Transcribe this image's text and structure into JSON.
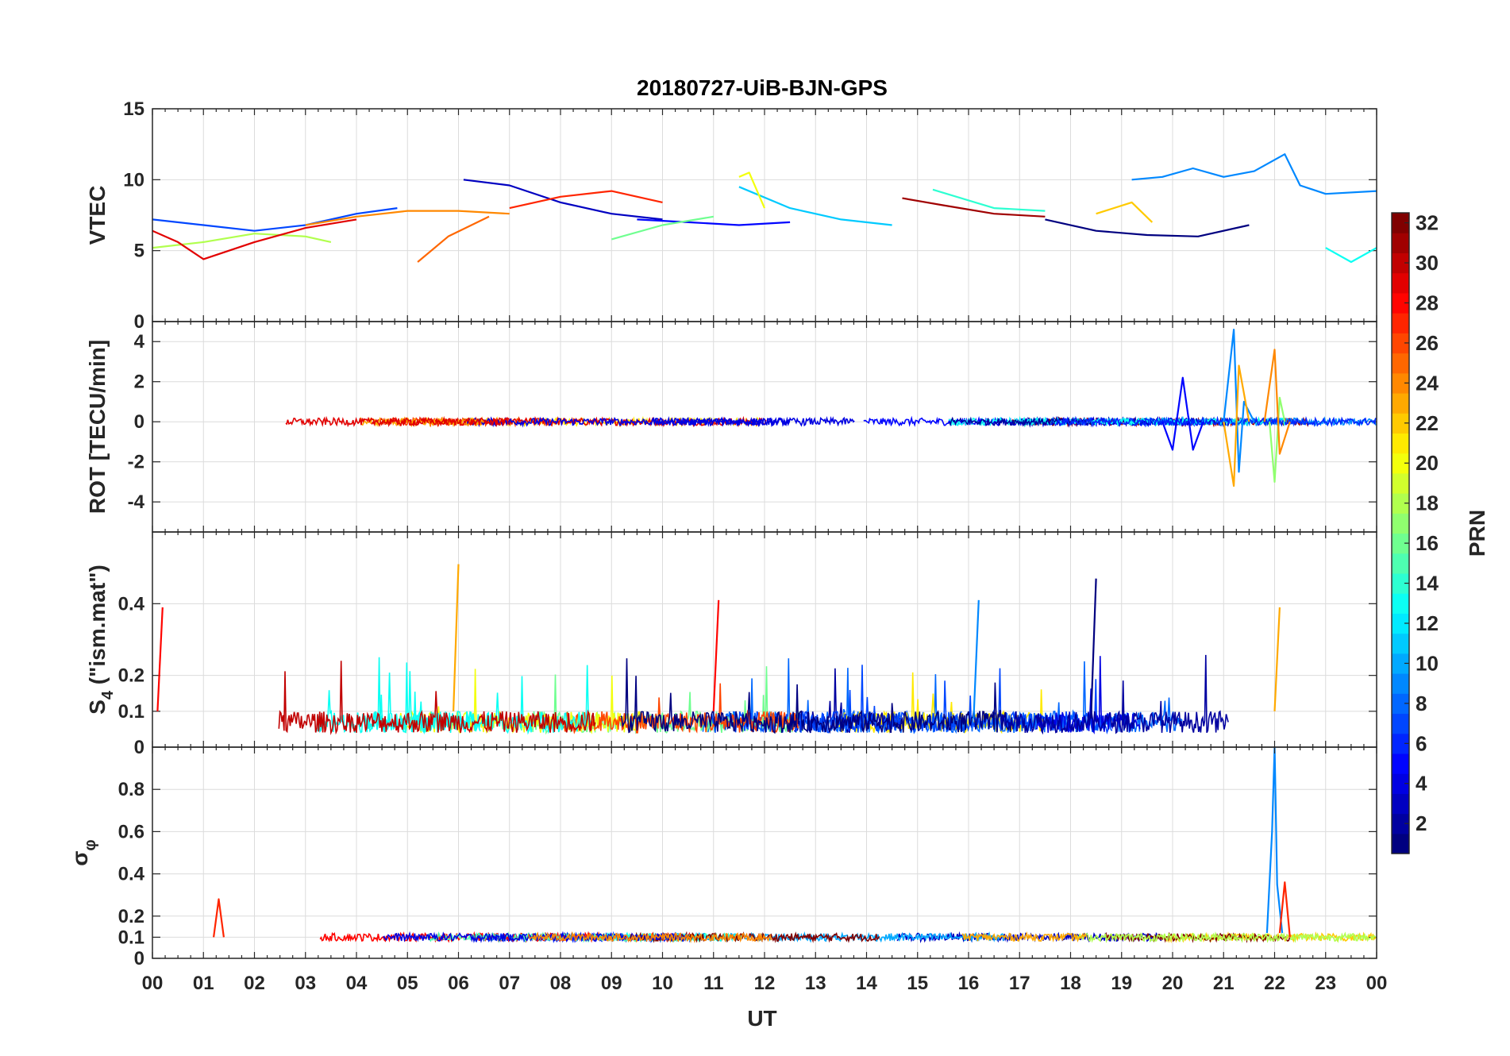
{
  "figure": {
    "title": "20180727-UiB-BJN-GPS",
    "xlabel": "UT",
    "x_ticks": [
      "00",
      "01",
      "02",
      "03",
      "04",
      "05",
      "06",
      "07",
      "08",
      "09",
      "10",
      "11",
      "12",
      "13",
      "14",
      "15",
      "16",
      "17",
      "18",
      "19",
      "20",
      "21",
      "22",
      "23",
      "00"
    ]
  },
  "colorbar": {
    "label": "PRN",
    "colormap": "jet",
    "range": [
      1,
      32
    ],
    "ticks": [
      "2",
      "4",
      "6",
      "8",
      "10",
      "12",
      "14",
      "16",
      "18",
      "20",
      "22",
      "24",
      "26",
      "28",
      "30",
      "32"
    ]
  },
  "chart_data": [
    {
      "type": "line",
      "panel": "vtec",
      "ylabel": "VTEC",
      "xlim": [
        0,
        24
      ],
      "ylim": [
        0,
        15
      ],
      "y_ticks": [
        "0",
        "5",
        "10",
        "15"
      ],
      "grid": true,
      "series_color_by": "PRN",
      "series": [
        {
          "prn": 1,
          "x": [
            17.5,
            18.5,
            19.5,
            20.5,
            21.5
          ],
          "y": [
            7.2,
            6.4,
            6.1,
            6.0,
            6.8
          ]
        },
        {
          "prn": 3,
          "x": [
            6.1,
            7.0,
            8.0,
            9.0,
            10.0
          ],
          "y": [
            10.0,
            9.6,
            8.4,
            7.6,
            7.2
          ]
        },
        {
          "prn": 5,
          "x": [
            9.5,
            10.5,
            11.5,
            12.5
          ],
          "y": [
            7.2,
            7.0,
            6.8,
            7.0
          ]
        },
        {
          "prn": 7,
          "x": [
            0.0,
            1.0,
            2.0,
            3.0,
            4.0,
            4.8
          ],
          "y": [
            7.2,
            6.8,
            6.4,
            6.8,
            7.6,
            8.0
          ]
        },
        {
          "prn": 9,
          "x": [
            19.2,
            19.8,
            20.4,
            21.0,
            21.6,
            22.2,
            22.5,
            23.0,
            24.0
          ],
          "y": [
            10.0,
            10.2,
            10.8,
            10.2,
            10.6,
            11.8,
            9.6,
            9.0,
            9.2
          ]
        },
        {
          "prn": 11,
          "x": [
            11.5,
            12.5,
            13.5,
            14.5
          ],
          "y": [
            9.5,
            8.0,
            7.2,
            6.8
          ]
        },
        {
          "prn": 13,
          "x": [
            23.0,
            23.5,
            24.0
          ],
          "y": [
            5.2,
            4.2,
            5.2
          ]
        },
        {
          "prn": 14,
          "x": [
            15.3,
            16.5,
            17.5
          ],
          "y": [
            9.3,
            8.0,
            7.8
          ]
        },
        {
          "prn": 16,
          "x": [
            9.0,
            10.0,
            11.0
          ],
          "y": [
            5.8,
            6.8,
            7.4
          ]
        },
        {
          "prn": 18,
          "x": [
            0.0,
            1.0,
            2.0,
            3.0,
            3.5
          ],
          "y": [
            5.2,
            5.6,
            6.2,
            6.0,
            5.6
          ]
        },
        {
          "prn": 20,
          "x": [
            11.5,
            11.7,
            12.0
          ],
          "y": [
            10.2,
            10.5,
            8.0
          ]
        },
        {
          "prn": 22,
          "x": [
            18.5,
            19.2,
            19.6
          ],
          "y": [
            7.6,
            8.4,
            7.0
          ]
        },
        {
          "prn": 24,
          "x": [
            3.0,
            4.0,
            5.0,
            6.0,
            7.0
          ],
          "y": [
            6.8,
            7.4,
            7.8,
            7.8,
            7.6
          ]
        },
        {
          "prn": 25,
          "x": [
            5.2,
            5.8,
            6.6
          ],
          "y": [
            4.2,
            6.0,
            7.4
          ]
        },
        {
          "prn": 27,
          "x": [
            7.0,
            8.0,
            9.0,
            10.0
          ],
          "y": [
            8.0,
            8.8,
            9.2,
            8.4
          ]
        },
        {
          "prn": 29,
          "x": [
            0.0,
            0.5,
            1.0,
            2.0,
            3.0,
            4.0
          ],
          "y": [
            6.4,
            5.6,
            4.4,
            5.6,
            6.6,
            7.2
          ]
        },
        {
          "prn": 31,
          "x": [
            14.7,
            15.5,
            16.5,
            17.5
          ],
          "y": [
            8.7,
            8.2,
            7.6,
            7.4
          ]
        }
      ]
    },
    {
      "type": "line",
      "panel": "rot",
      "ylabel": "ROT [TECU/min]",
      "xlim": [
        0,
        24
      ],
      "ylim": [
        -5.5,
        5
      ],
      "y_ticks": [
        "-4",
        "-2",
        "0",
        "2",
        "4"
      ],
      "grid": true,
      "series_color_by": "PRN",
      "series": [
        {
          "prn": 5,
          "x": [
            19.8,
            20.0,
            20.2,
            20.4,
            20.6
          ],
          "y": [
            0.0,
            -1.4,
            2.2,
            -1.4,
            0.0
          ]
        },
        {
          "prn": 9,
          "x": [
            21.0,
            21.2,
            21.3,
            21.4,
            21.6
          ],
          "y": [
            0.0,
            4.6,
            -2.5,
            1.0,
            0.0
          ]
        },
        {
          "prn": 17,
          "x": [
            21.9,
            22.0,
            22.1,
            22.2
          ],
          "y": [
            0.0,
            -3.0,
            1.2,
            0.0
          ]
        },
        {
          "prn": 23,
          "x": [
            21.0,
            21.2,
            21.3,
            21.5
          ],
          "y": [
            0.0,
            -3.2,
            2.8,
            0.0
          ]
        },
        {
          "prn": 24,
          "x": [
            21.8,
            22.0,
            22.1,
            22.3
          ],
          "y": [
            0.0,
            3.6,
            -1.6,
            0.0
          ]
        }
      ]
    },
    {
      "type": "line",
      "panel": "s4",
      "ylabel_main": "S",
      "ylabel_sub": "4",
      "ylabel_rest": " (\"ism.mat\")",
      "xlim": [
        0,
        24
      ],
      "ylim": [
        0,
        0.6
      ],
      "y_ticks": [
        "0",
        "0.1",
        "0.2",
        "0.4"
      ],
      "grid": true,
      "series_color_by": "PRN",
      "series": [
        {
          "prn": 1,
          "x": [
            18.4,
            18.5
          ],
          "y": [
            0.08,
            0.47
          ]
        },
        {
          "prn": 9,
          "x": [
            16.1,
            16.2
          ],
          "y": [
            0.08,
            0.41
          ]
        },
        {
          "prn": 23,
          "x": [
            5.9,
            6.0
          ],
          "y": [
            0.1,
            0.51
          ]
        },
        {
          "prn": 23,
          "x": [
            22.0,
            22.1
          ],
          "y": [
            0.1,
            0.39
          ]
        },
        {
          "prn": 28,
          "x": [
            0.1,
            0.2
          ],
          "y": [
            0.1,
            0.39
          ]
        },
        {
          "prn": 28,
          "x": [
            11.0,
            11.1
          ],
          "y": [
            0.1,
            0.41
          ]
        }
      ]
    },
    {
      "type": "line",
      "panel": "sigma_phi",
      "ylabel": "σ_φ",
      "ylabel_main": "σ",
      "ylabel_sub": "φ",
      "xlim": [
        0,
        24
      ],
      "ylim": [
        0,
        1
      ],
      "y_ticks": [
        "0",
        "0.1",
        "0.2",
        "0.4",
        "0.6",
        "0.8"
      ],
      "grid": true,
      "series_color_by": "PRN",
      "series": [
        {
          "prn": 9,
          "x": [
            21.85,
            21.95,
            22.0,
            22.05,
            22.15
          ],
          "y": [
            0.12,
            0.6,
            1.0,
            0.35,
            0.12
          ]
        },
        {
          "prn": 27,
          "x": [
            22.1,
            22.2,
            22.3
          ],
          "y": [
            0.12,
            0.36,
            0.1
          ]
        },
        {
          "prn": 27,
          "x": [
            1.2,
            1.3,
            1.4
          ],
          "y": [
            0.1,
            0.28,
            0.1
          ]
        }
      ]
    }
  ]
}
